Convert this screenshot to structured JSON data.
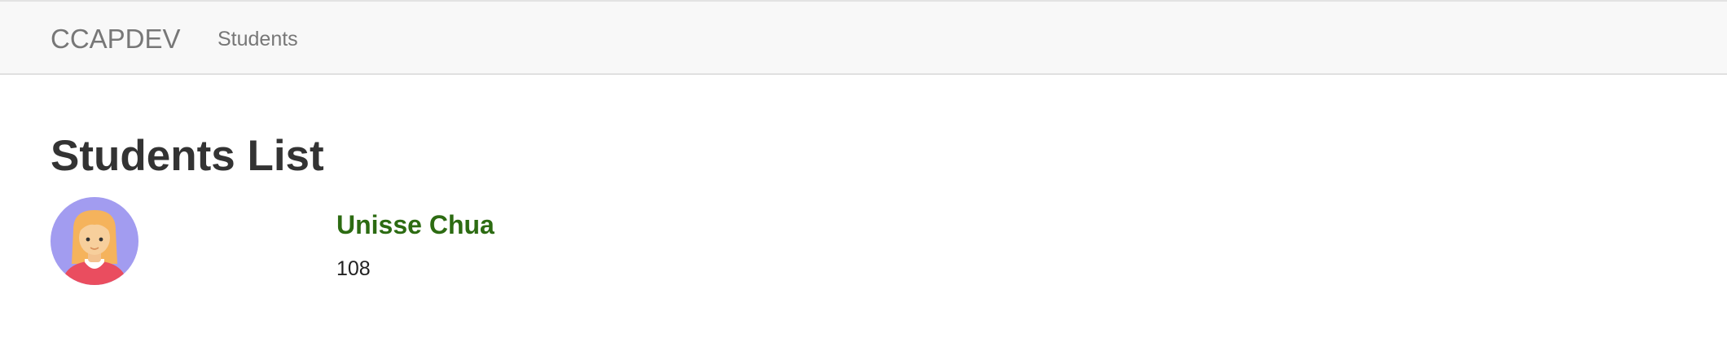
{
  "navbar": {
    "brand": "CCAPDEV",
    "links": [
      {
        "label": "Students"
      }
    ]
  },
  "main": {
    "title": "Students List",
    "students": [
      {
        "name": "Unisse Chua",
        "id": "108",
        "avatar_icon": "female-avatar-icon"
      }
    ]
  },
  "colors": {
    "navbar_bg": "#f8f8f8",
    "nav_text": "#777777",
    "title_text": "#333333",
    "student_name": "#2c6b12",
    "avatar_bg": "#a29cf0",
    "avatar_hair": "#f5b35c",
    "avatar_shirt": "#ea4d5f"
  }
}
